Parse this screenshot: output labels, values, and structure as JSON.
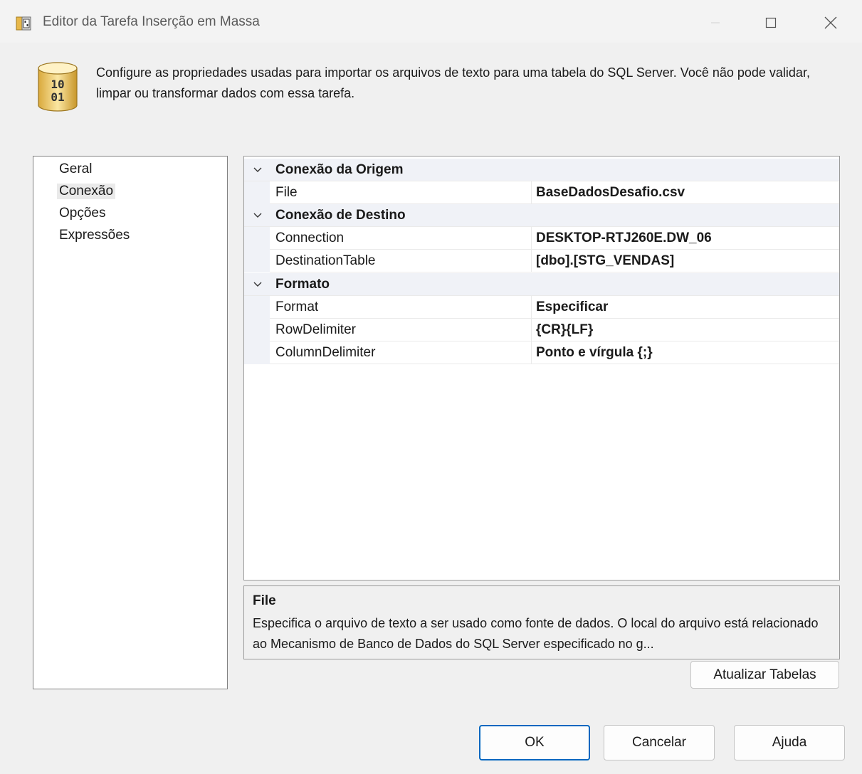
{
  "window": {
    "title": "Editor da Tarefa Inserção em Massa"
  },
  "header": {
    "description": "Configure as propriedades usadas para importar os arquivos de texto para uma tabela do SQL Server. Você não pode validar, limpar ou transformar dados com essa tarefa."
  },
  "nav": {
    "items": [
      {
        "label": "Geral"
      },
      {
        "label": "Conexão"
      },
      {
        "label": "Opções"
      },
      {
        "label": "Expressões"
      }
    ]
  },
  "grid": {
    "categories": [
      {
        "label": "Conexão da Origem",
        "properties": [
          {
            "name": "File",
            "value": "BaseDadosDesafio.csv"
          }
        ]
      },
      {
        "label": "Conexão de Destino",
        "properties": [
          {
            "name": "Connection",
            "value": "DESKTOP-RTJ260E.DW_06"
          },
          {
            "name": "DestinationTable",
            "value": "[dbo].[STG_VENDAS]"
          }
        ]
      },
      {
        "label": "Formato",
        "properties": [
          {
            "name": "Format",
            "value": "Especificar"
          },
          {
            "name": "RowDelimiter",
            "value": "{CR}{LF}"
          },
          {
            "name": "ColumnDelimiter",
            "value": "Ponto e vírgula {;}"
          }
        ]
      }
    ]
  },
  "description_panel": {
    "title": "File",
    "text": "Especifica o arquivo de texto a ser usado como fonte de dados. O local do arquivo está relacionado ao Mecanismo de Banco de Dados do SQL Server especificado no g..."
  },
  "buttons": {
    "refresh_tables": "Atualizar Tabelas",
    "ok": "OK",
    "cancel": "Cancelar",
    "help": "Ajuda"
  }
}
